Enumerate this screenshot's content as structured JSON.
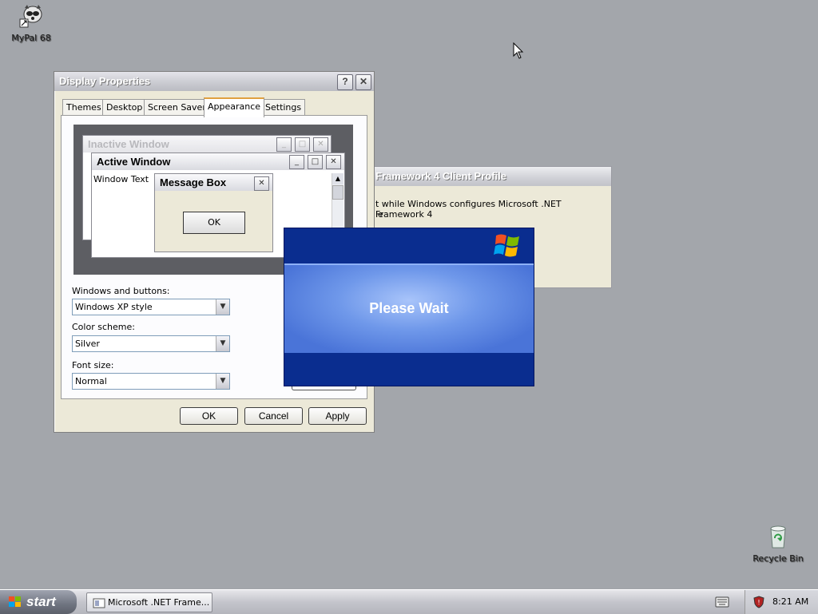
{
  "desktop": {
    "icons": [
      {
        "label": "MyPal 68",
        "icon": "raccoon-icon"
      },
      {
        "label": "Recycle Bin",
        "icon": "recycle-bin-icon"
      }
    ]
  },
  "display_properties": {
    "title": "Display Properties",
    "tabs": [
      "Themes",
      "Desktop",
      "Screen Saver",
      "Appearance",
      "Settings"
    ],
    "active_tab": "Appearance",
    "preview": {
      "inactive_title": "Inactive Window",
      "active_title": "Active Window",
      "window_text": "Window Text",
      "message_box_title": "Message Box",
      "message_box_ok": "OK"
    },
    "windows_buttons_label": "Windows and buttons:",
    "windows_buttons_value": "Windows XP style",
    "color_scheme_label": "Color scheme:",
    "color_scheme_value": "Silver",
    "font_size_label": "Font size:",
    "font_size_value": "Normal",
    "ok_label": "OK",
    "cancel_label": "Cancel",
    "apply_label": "Apply"
  },
  "dotnet_window": {
    "title": "Framework 4 Client Profile",
    "text_line1": "t while Windows configures Microsoft .NET Framework 4",
    "text_line2": "le"
  },
  "splash": {
    "message": "Please Wait"
  },
  "taskbar": {
    "start_label": "start",
    "task_label": "Microsoft .NET Frame...",
    "clock": "8:21 AM"
  },
  "colors": {
    "desktop_bg": "#a3a6ab",
    "splash_blue": "#0a2d8f"
  }
}
